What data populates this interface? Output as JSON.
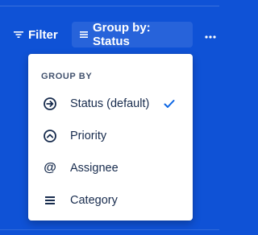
{
  "colors": {
    "background": "#0f52d6",
    "menu_text": "#172b4d",
    "header_text": "#42526e",
    "check": "#0c66e4"
  },
  "toolbar": {
    "filter_label": "Filter",
    "filter_icon": "filter-icon",
    "group_by_label": "Group by: Status",
    "group_by_icon": "group-lines-icon",
    "more_icon": "more-horizontal-icon"
  },
  "group_menu": {
    "header": "GROUP BY",
    "items": [
      {
        "label": "Status (default)",
        "icon": "status-arrow-circle-icon",
        "selected": true
      },
      {
        "label": "Priority",
        "icon": "priority-chevron-circle-icon",
        "selected": false
      },
      {
        "label": "Assignee",
        "icon": "at-sign-icon",
        "selected": false
      },
      {
        "label": "Category",
        "icon": "category-lines-icon",
        "selected": false
      }
    ]
  }
}
